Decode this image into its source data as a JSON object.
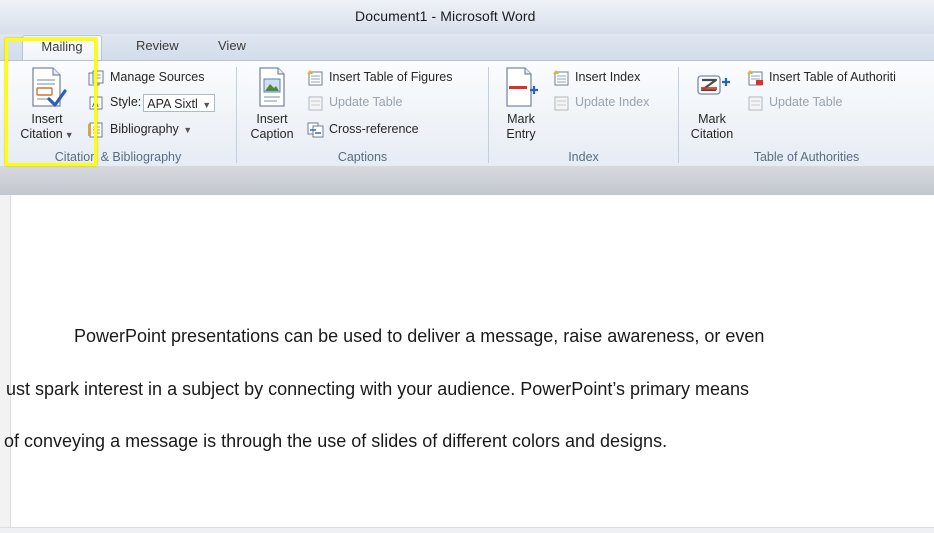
{
  "window": {
    "title": "Document1  -  Microsoft Word"
  },
  "tabs": [
    {
      "label": "Mailing",
      "active": true
    },
    {
      "label": "Review",
      "active": false
    },
    {
      "label": "View",
      "active": false
    }
  ],
  "groups": {
    "citations": {
      "label": "Citation  & Bibliography",
      "insert_citation_line1": "Insert",
      "insert_citation_line2": "Citation",
      "manage_sources": "Manage Sources",
      "style_label": "Style:",
      "style_value": "APA Sixtl",
      "bibliography": "Bibliography"
    },
    "captions": {
      "label": "Captions",
      "insert_caption_line1": "Insert",
      "insert_caption_line2": "Caption",
      "insert_table_of_figures": "Insert Table of Figures",
      "update_table": "Update Table",
      "cross_reference": "Cross-reference"
    },
    "index": {
      "label": "Index",
      "mark_entry_line1": "Mark",
      "mark_entry_line2": "Entry",
      "insert_index": "Insert Index",
      "update_index": "Update Index"
    },
    "authorities": {
      "label": "Table of Authorities",
      "mark_citation_line1": "Mark",
      "mark_citation_line2": "Citation",
      "insert_table_of_authorities": "Insert Table of Authoriti",
      "update_table": "Update Table"
    }
  },
  "document": {
    "lines": [
      "PowerPoint presentations can be used to deliver a message, raise awareness, or even",
      "ust spark interest in a subject by connecting with your audience. PowerPoint’s primary means",
      "of conveying a message is through the use of slides of different colors and designs."
    ]
  },
  "colors": {
    "highlight": "#ffff00",
    "ribbon_text": "#5a6b82"
  }
}
